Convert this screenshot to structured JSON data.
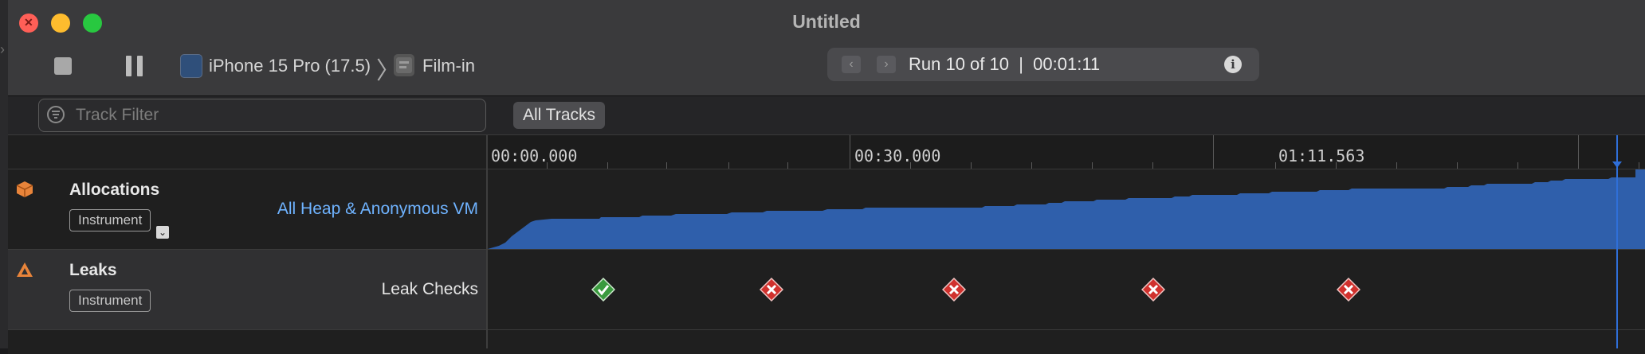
{
  "window": {
    "title": "Untitled"
  },
  "toolbar": {
    "device": "iPhone 15 Pro (17.5)",
    "breadcrumb_separator": "〉",
    "app": "Film-in",
    "run_label": "Run 10 of 10  |  00:01:11",
    "stop_icon": "stop-icon",
    "pause_icon": "pause-icon",
    "info_icon": "info-icon"
  },
  "filter": {
    "placeholder": "Track Filter",
    "value": "",
    "all_tracks": "All Tracks"
  },
  "ruler": {
    "ticks": [
      "00:00.000",
      "00:30.000",
      "01:11.563"
    ]
  },
  "tracks": [
    {
      "name": "Allocations",
      "badge": "Instrument",
      "detail": "All Heap & Anonymous VM",
      "icon": "allocations-box-icon",
      "detail_color": "#6fb3ff"
    },
    {
      "name": "Leaks",
      "badge": "Instrument",
      "detail": "Leak Checks",
      "icon": "leaks-warning-icon",
      "detail_color": "#e6e6e6"
    }
  ],
  "leak_checks": [
    "pass",
    "fail",
    "fail",
    "fail",
    "fail"
  ],
  "colors": {
    "graph_fill": "#2f5fab",
    "playhead": "#2f6fd8",
    "pass": "#3a9a3e",
    "fail": "#d0312d",
    "allocations_icon": "#e8843a",
    "leaks_icon": "#e8843a"
  }
}
